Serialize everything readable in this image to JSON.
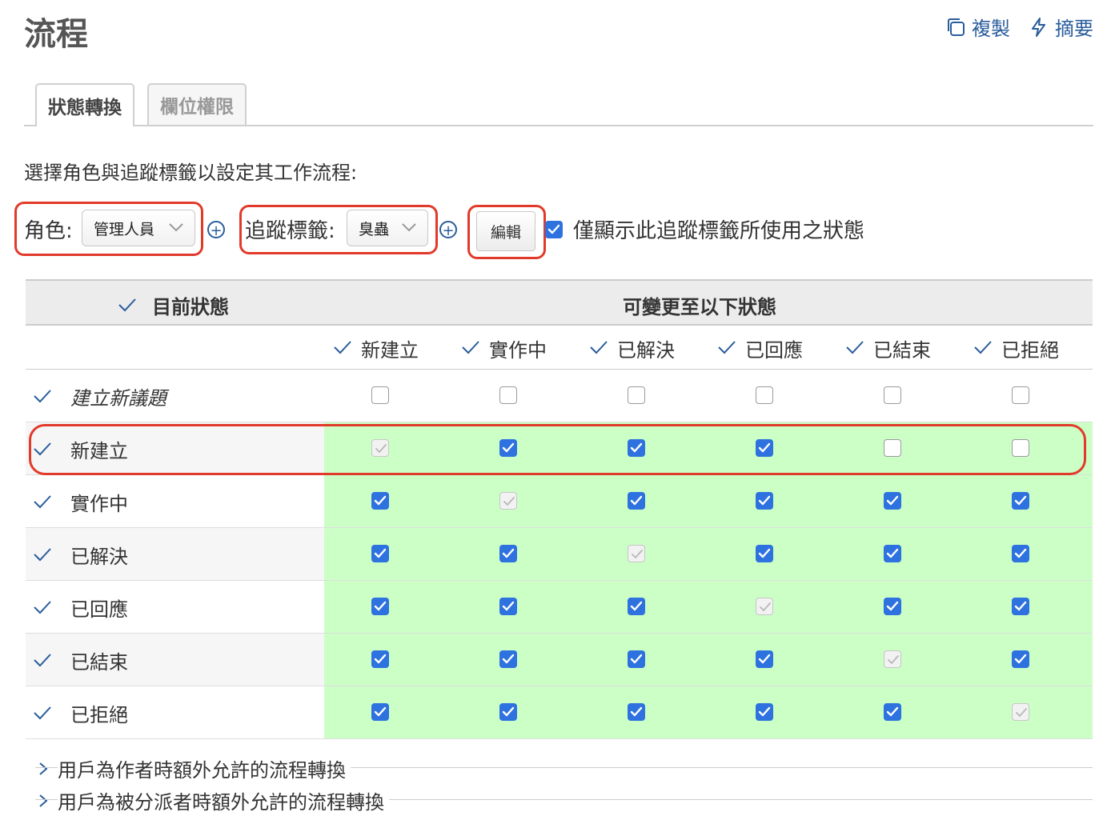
{
  "page": {
    "title": "流程"
  },
  "actions": {
    "copy_label": "複製",
    "summary_label": "摘要"
  },
  "tabs": [
    {
      "label": "狀態轉換",
      "selected": true
    },
    {
      "label": "欄位權限",
      "selected": false
    }
  ],
  "intro": "選擇角色與追蹤標籤以設定其工作流程:",
  "filters": {
    "role_label": "角色:",
    "role_value": "管理人員",
    "tracker_label": "追蹤標籤:",
    "tracker_value": "臭蟲",
    "edit_button": "編輯",
    "only_used_label": "僅顯示此追蹤標籤所使用之狀態",
    "only_used_checked": true
  },
  "table": {
    "current_status_header": "目前狀態",
    "new_status_header": "可變更至以下狀態",
    "columns": [
      "新建立",
      "實作中",
      "已解決",
      "已回應",
      "已結束",
      "已拒絕"
    ],
    "rows": [
      {
        "name": "建立新議題",
        "italic": true,
        "highlight": false,
        "cells": [
          "off",
          "off",
          "off",
          "off",
          "off",
          "off"
        ]
      },
      {
        "name": "新建立",
        "italic": false,
        "highlight": true,
        "cells": [
          "dis",
          "on",
          "on",
          "on",
          "off",
          "off"
        ]
      },
      {
        "name": "實作中",
        "italic": false,
        "highlight": true,
        "cells": [
          "on",
          "dis",
          "on",
          "on",
          "on",
          "on"
        ]
      },
      {
        "name": "已解決",
        "italic": false,
        "highlight": true,
        "cells": [
          "on",
          "on",
          "dis",
          "on",
          "on",
          "on"
        ]
      },
      {
        "name": "已回應",
        "italic": false,
        "highlight": true,
        "cells": [
          "on",
          "on",
          "on",
          "dis",
          "on",
          "on"
        ]
      },
      {
        "name": "已結束",
        "italic": false,
        "highlight": true,
        "cells": [
          "on",
          "on",
          "on",
          "on",
          "dis",
          "on"
        ]
      },
      {
        "name": "已拒絕",
        "italic": false,
        "highlight": true,
        "cells": [
          "on",
          "on",
          "on",
          "on",
          "on",
          "dis"
        ]
      }
    ]
  },
  "fieldsets": [
    {
      "label": "用戶為作者時額外允許的流程轉換"
    },
    {
      "label": "用戶為被分派者時額外允許的流程轉換"
    }
  ],
  "colors": {
    "accent": "#2e72e0",
    "link": "#2a5d9c",
    "annotation": "#e23a2a",
    "allowed_bg": "#ccffc6"
  },
  "icons": [
    "copy-icon",
    "lightning-icon",
    "chevron-down-icon",
    "plus-circle-icon",
    "check-icon",
    "chevron-right-icon"
  ]
}
